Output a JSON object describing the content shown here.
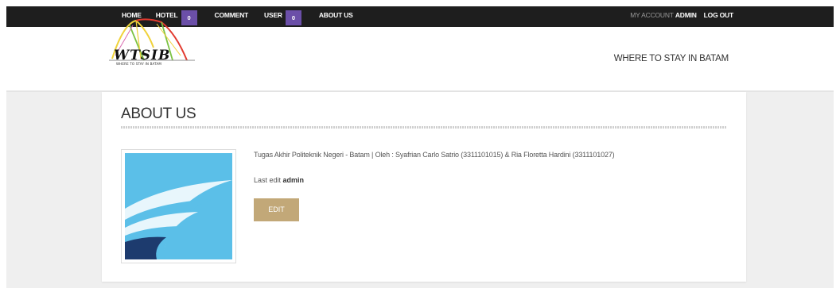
{
  "nav": {
    "home": "HOME",
    "hotel": "HOTEL",
    "hotel_count": "0",
    "comment": "COMMENT",
    "user": "USER",
    "user_count": "0",
    "about": "ABOUT US",
    "my_account_prefix": "MY ACCOUNT",
    "username": "ADMIN",
    "logout": "LOG OUT"
  },
  "header": {
    "logo_text": "WTSIB",
    "logo_subtext": "WHERE TO STAY IN BATAM",
    "site_title": "WHERE TO STAY IN BATAM"
  },
  "page": {
    "title": "ABOUT US",
    "description": "Tugas Akhir Politeknik Negeri - Batam | Oleh : Syafrian Carlo Satrio (3311101015) & Ria Floretta Hardini (3311101027)",
    "last_edit_label": "Last edit",
    "last_edit_user": "admin",
    "edit_button": "EDIT"
  },
  "colors": {
    "topbar": "#1e1e1e",
    "badge": "#6b4fa8",
    "edit_button": "#c2a878",
    "page_background": "#efefef",
    "image_sky": "#5bbfe8",
    "image_dark": "#1d3b6e"
  }
}
